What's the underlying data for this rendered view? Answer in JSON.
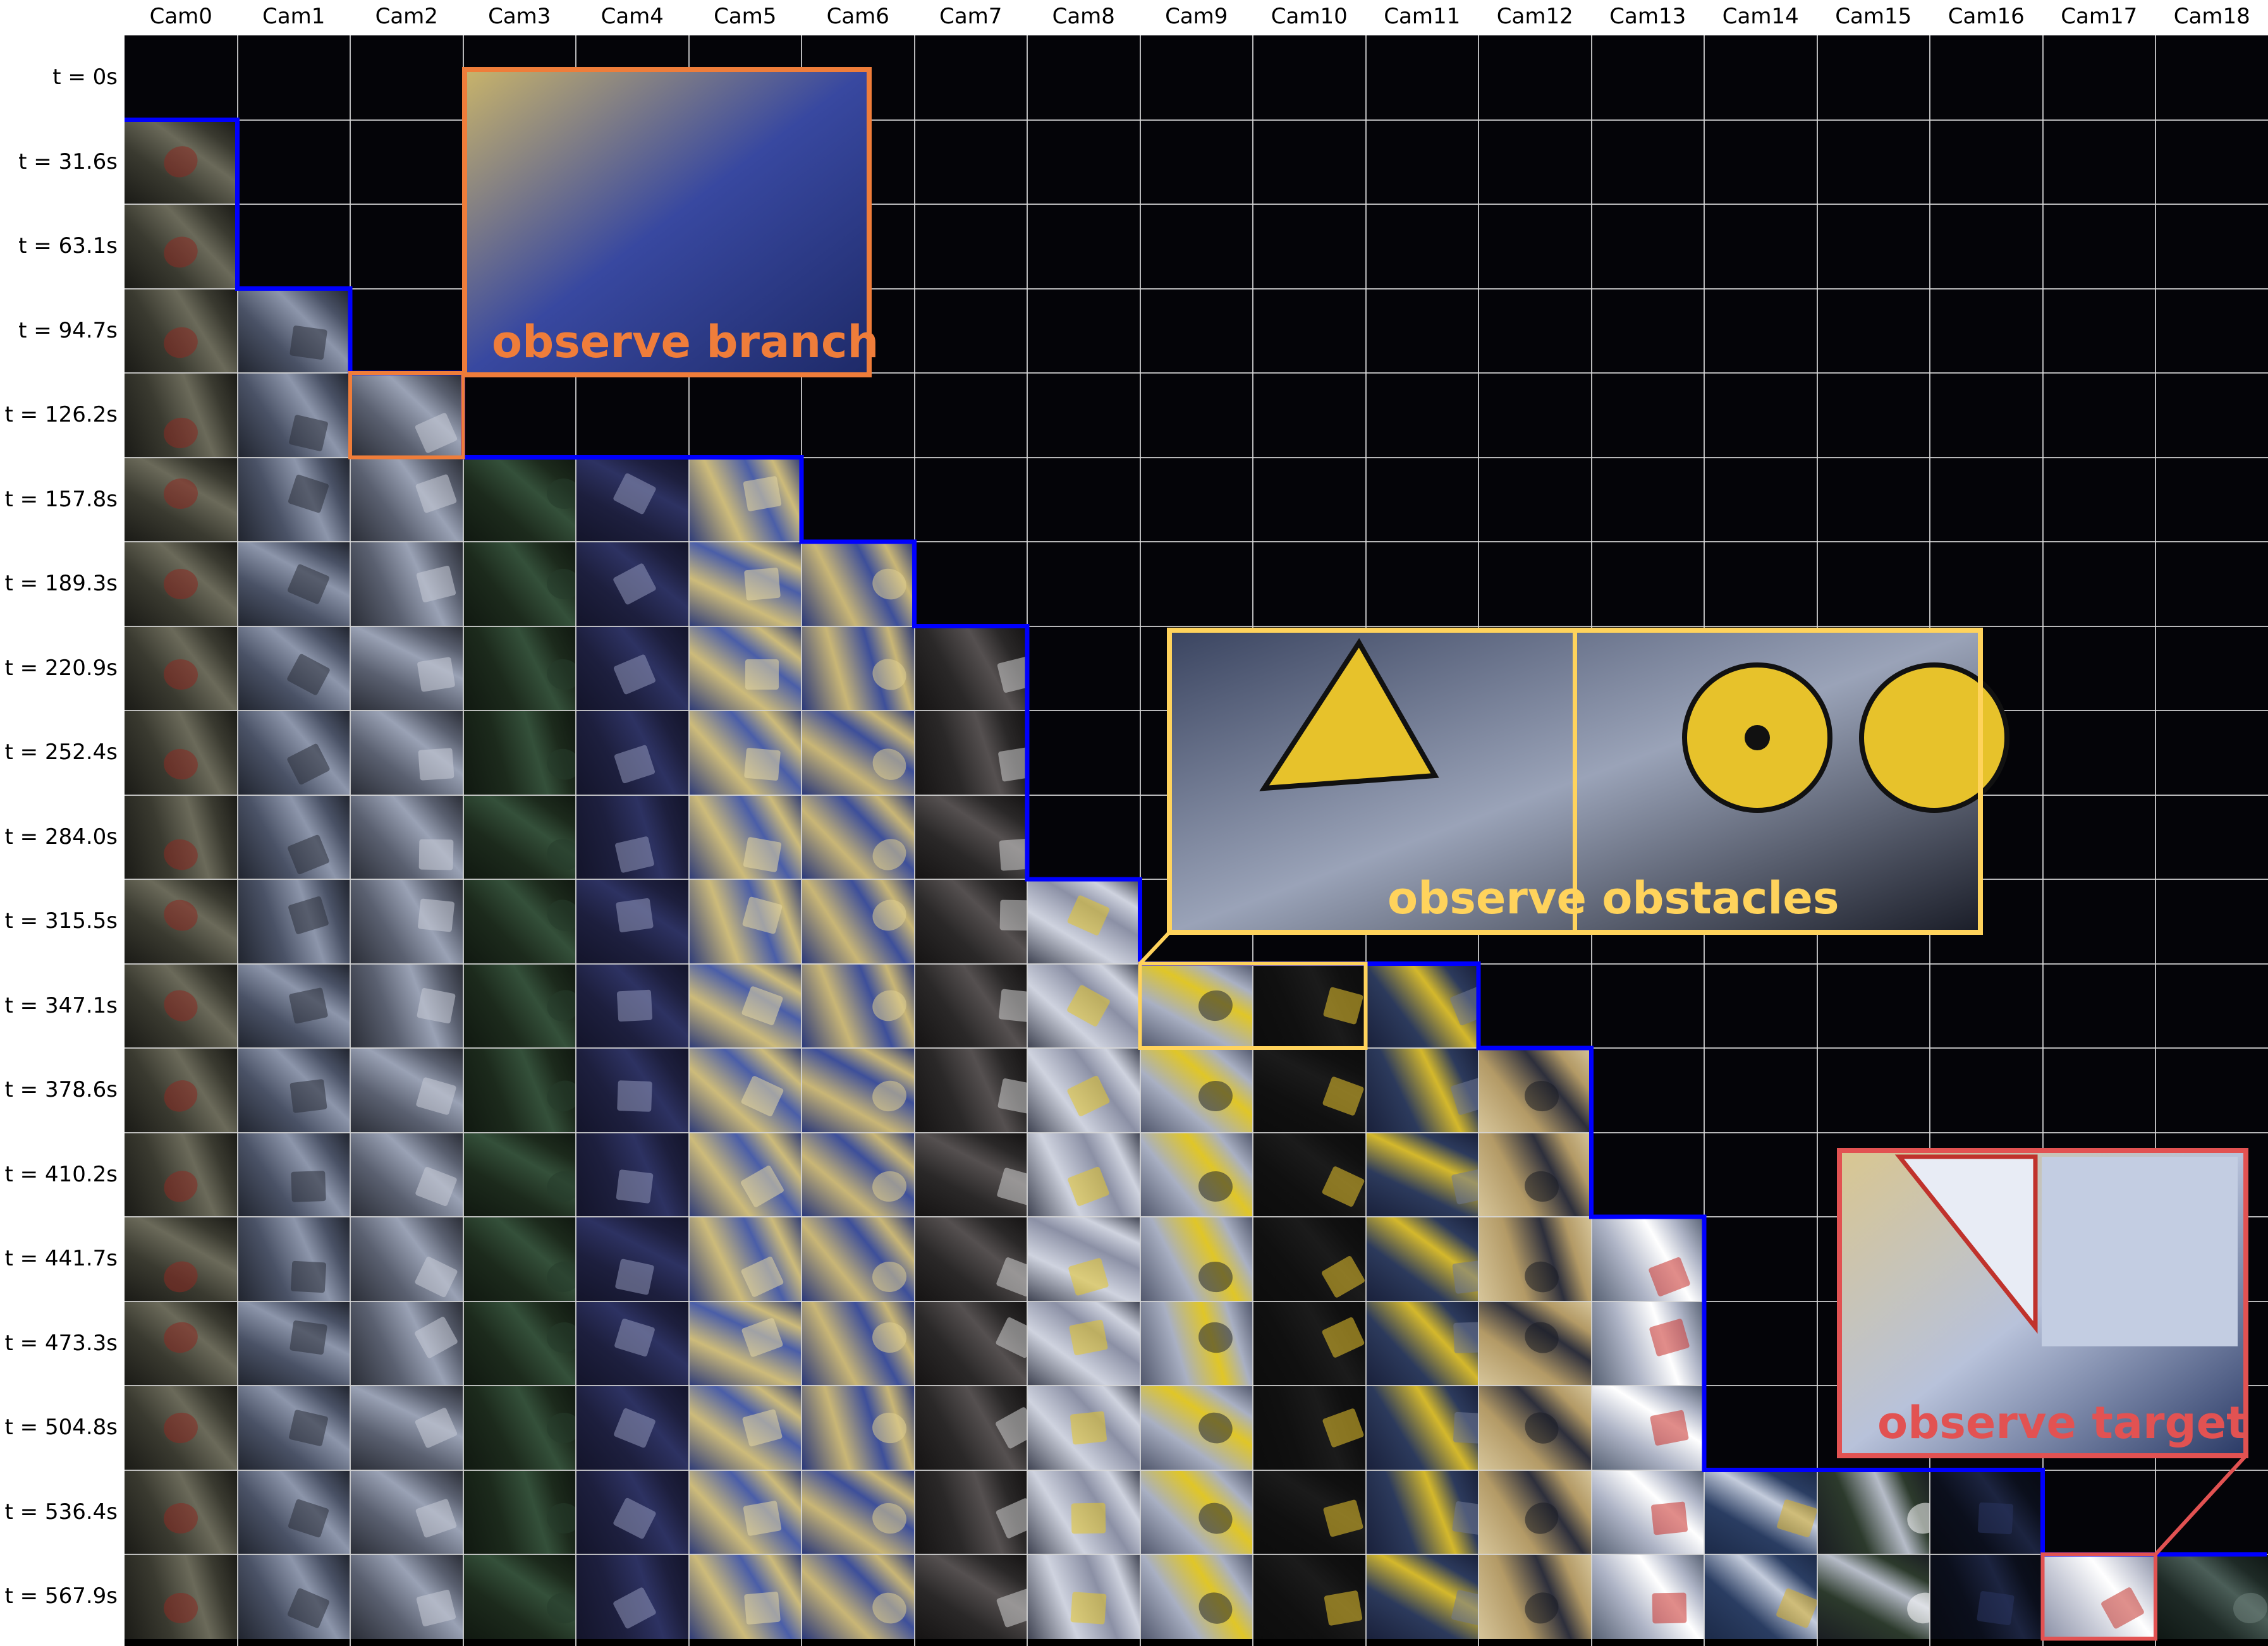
{
  "columns": [
    "Cam0",
    "Cam1",
    "Cam2",
    "Cam3",
    "Cam4",
    "Cam5",
    "Cam6",
    "Cam7",
    "Cam8",
    "Cam9",
    "Cam10",
    "Cam11",
    "Cam12",
    "Cam13",
    "Cam14",
    "Cam15",
    "Cam16",
    "Cam17",
    "Cam18"
  ],
  "rows": [
    "t = 0s",
    "t = 31.6s",
    "t = 63.1s",
    "t = 94.7s",
    "t = 126.2s",
    "t = 157.8s",
    "t = 189.3s",
    "t = 220.9s",
    "t = 252.4s",
    "t = 284.0s",
    "t = 315.5s",
    "t = 347.1s",
    "t = 378.6s",
    "t = 410.2s",
    "t = 441.7s",
    "t = 473.3s",
    "t = 504.8s",
    "t = 536.4s",
    "t = 567.9s"
  ],
  "camera_start_row": [
    1,
    3,
    4,
    5,
    5,
    5,
    6,
    7,
    10,
    11,
    11,
    11,
    12,
    14,
    17,
    17,
    17,
    18,
    18
  ],
  "callouts": [
    {
      "label": "observe branch",
      "color": "#ef7d3a",
      "source_cells": [
        {
          "cam": 2,
          "row": 4
        }
      ]
    },
    {
      "label": "observe obstacles",
      "color": "#ffd35c",
      "source_cells": [
        {
          "cam": 9,
          "row": 11
        },
        {
          "cam": 10,
          "row": 11
        }
      ]
    },
    {
      "label": "observe target",
      "color": "#e25252",
      "source_cells": [
        {
          "cam": 17,
          "row": 18
        }
      ]
    }
  ],
  "frontier_color": "#0000ff"
}
